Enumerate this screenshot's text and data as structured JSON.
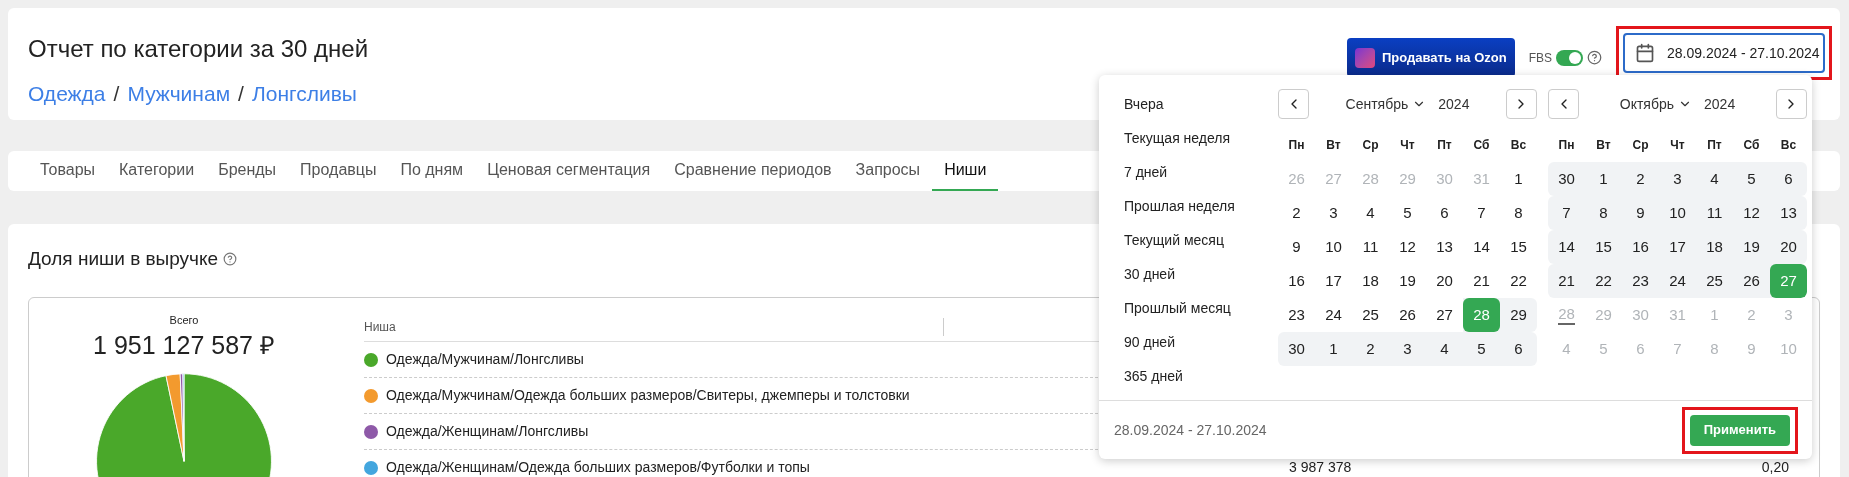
{
  "header": {
    "title": "Отчет по категории за 30 дней",
    "breadcrumbs": [
      "Одежда",
      "Мужчинам",
      "Лонгсливы"
    ],
    "separators": [
      "/",
      "/"
    ],
    "sell_button": "Продавать на Ozon",
    "fbs": {
      "label": "FBS",
      "on": true
    },
    "date_range": {
      "value": "28.09.2024 - 27.10.2024",
      "highlighted": true
    }
  },
  "tabs": [
    {
      "label": "Товары",
      "selected": false
    },
    {
      "label": "Категории",
      "selected": false
    },
    {
      "label": "Бренды",
      "selected": false
    },
    {
      "label": "Продавцы",
      "selected": false
    },
    {
      "label": "По дням",
      "selected": false
    },
    {
      "label": "Ценовая сегментация",
      "selected": false
    },
    {
      "label": "Сравнение периодов",
      "selected": false
    },
    {
      "label": "Запросы",
      "selected": false
    },
    {
      "label": "Ниши",
      "selected": true
    }
  ],
  "section": {
    "title": "Доля ниши в выручке",
    "total_label": "Всего",
    "total": "1 951 127 587 ₽",
    "columns": [
      "Ниша"
    ],
    "rows": [
      {
        "name": "Одежда/Мужчинам/Лонгсливы",
        "color": "#4aa82a"
      },
      {
        "name": "Одежда/Мужчинам/Одежда больших размеров/Свитеры, джемперы и толстовки",
        "color": "#f39a2e"
      },
      {
        "name": "Одежда/Женщинам/Лонгсливы",
        "color": "#8e59a8"
      },
      {
        "name": "Одежда/Женщинам/Одежда больших размеров/Футболки и топы",
        "color": "#43a6de",
        "column_2": "3 987 378",
        "column_3": "0,20"
      }
    ]
  },
  "calendar": {
    "presets": [
      "Вчера",
      "Текущая неделя",
      "7 дней",
      "Прошлая неделя",
      "Текущий месяц",
      "30 дней",
      "Прошлый месяц",
      "90 дней",
      "365 дней"
    ],
    "months": [
      {
        "month": "Сентябрь",
        "year": "2024",
        "weekdays": [
          "Пн",
          "Вт",
          "Ср",
          "Чт",
          "Пт",
          "Сб",
          "Вс"
        ],
        "weeks": [
          [
            {
              "d": "26",
              "muted": true,
              "in_range": false,
              "selected": false,
              "today": false
            },
            {
              "d": "27",
              "muted": true,
              "in_range": false,
              "selected": false,
              "today": false
            },
            {
              "d": "28",
              "muted": true,
              "in_range": false,
              "selected": false,
              "today": false
            },
            {
              "d": "29",
              "muted": true,
              "in_range": false,
              "selected": false,
              "today": false
            },
            {
              "d": "30",
              "muted": true,
              "in_range": false,
              "selected": false,
              "today": false
            },
            {
              "d": "31",
              "muted": true,
              "in_range": false,
              "selected": false,
              "today": false
            },
            {
              "d": "1",
              "muted": false,
              "in_range": false,
              "selected": false,
              "today": false
            }
          ],
          [
            {
              "d": "2",
              "muted": false,
              "in_range": false,
              "selected": false,
              "today": false
            },
            {
              "d": "3",
              "muted": false,
              "in_range": false,
              "selected": false,
              "today": false
            },
            {
              "d": "4",
              "muted": false,
              "in_range": false,
              "selected": false,
              "today": false
            },
            {
              "d": "5",
              "muted": false,
              "in_range": false,
              "selected": false,
              "today": false
            },
            {
              "d": "6",
              "muted": false,
              "in_range": false,
              "selected": false,
              "today": false
            },
            {
              "d": "7",
              "muted": false,
              "in_range": false,
              "selected": false,
              "today": false
            },
            {
              "d": "8",
              "muted": false,
              "in_range": false,
              "selected": false,
              "today": false
            }
          ],
          [
            {
              "d": "9",
              "muted": false,
              "in_range": false,
              "selected": false,
              "today": false
            },
            {
              "d": "10",
              "muted": false,
              "in_range": false,
              "selected": false,
              "today": false
            },
            {
              "d": "11",
              "muted": false,
              "in_range": false,
              "selected": false,
              "today": false
            },
            {
              "d": "12",
              "muted": false,
              "in_range": false,
              "selected": false,
              "today": false
            },
            {
              "d": "13",
              "muted": false,
              "in_range": false,
              "selected": false,
              "today": false
            },
            {
              "d": "14",
              "muted": false,
              "in_range": false,
              "selected": false,
              "today": false
            },
            {
              "d": "15",
              "muted": false,
              "in_range": false,
              "selected": false,
              "today": false
            }
          ],
          [
            {
              "d": "16",
              "muted": false,
              "in_range": false,
              "selected": false,
              "today": false
            },
            {
              "d": "17",
              "muted": false,
              "in_range": false,
              "selected": false,
              "today": false
            },
            {
              "d": "18",
              "muted": false,
              "in_range": false,
              "selected": false,
              "today": false
            },
            {
              "d": "19",
              "muted": false,
              "in_range": false,
              "selected": false,
              "today": false
            },
            {
              "d": "20",
              "muted": false,
              "in_range": false,
              "selected": false,
              "today": false
            },
            {
              "d": "21",
              "muted": false,
              "in_range": false,
              "selected": false,
              "today": false
            },
            {
              "d": "22",
              "muted": false,
              "in_range": false,
              "selected": false,
              "today": false
            }
          ],
          [
            {
              "d": "23",
              "muted": false,
              "in_range": false,
              "selected": false,
              "today": false
            },
            {
              "d": "24",
              "muted": false,
              "in_range": false,
              "selected": false,
              "today": false
            },
            {
              "d": "25",
              "muted": false,
              "in_range": false,
              "selected": false,
              "today": false
            },
            {
              "d": "26",
              "muted": false,
              "in_range": false,
              "selected": false,
              "today": false
            },
            {
              "d": "27",
              "muted": false,
              "in_range": false,
              "selected": false,
              "today": false
            },
            {
              "d": "28",
              "muted": false,
              "in_range": true,
              "selected": true,
              "today": false
            },
            {
              "d": "29",
              "muted": false,
              "in_range": true,
              "selected": false,
              "today": false
            }
          ],
          [
            {
              "d": "30",
              "muted": false,
              "in_range": true,
              "selected": false,
              "today": false
            },
            {
              "d": "1",
              "muted": false,
              "in_range": true,
              "selected": false,
              "today": false
            },
            {
              "d": "2",
              "muted": false,
              "in_range": true,
              "selected": false,
              "today": false
            },
            {
              "d": "3",
              "muted": false,
              "in_range": true,
              "selected": false,
              "today": false
            },
            {
              "d": "4",
              "muted": false,
              "in_range": true,
              "selected": false,
              "today": false
            },
            {
              "d": "5",
              "muted": false,
              "in_range": true,
              "selected": false,
              "today": false
            },
            {
              "d": "6",
              "muted": false,
              "in_range": true,
              "selected": false,
              "today": false
            }
          ]
        ]
      },
      {
        "month": "Октябрь",
        "year": "2024",
        "weekdays": [
          "Пн",
          "Вт",
          "Ср",
          "Чт",
          "Пт",
          "Сб",
          "Вс"
        ],
        "weeks": [
          [
            {
              "d": "30",
              "muted": false,
              "in_range": true,
              "selected": false,
              "today": false
            },
            {
              "d": "1",
              "muted": false,
              "in_range": true,
              "selected": false,
              "today": false
            },
            {
              "d": "2",
              "muted": false,
              "in_range": true,
              "selected": false,
              "today": false
            },
            {
              "d": "3",
              "muted": false,
              "in_range": true,
              "selected": false,
              "today": false
            },
            {
              "d": "4",
              "muted": false,
              "in_range": true,
              "selected": false,
              "today": false
            },
            {
              "d": "5",
              "muted": false,
              "in_range": true,
              "selected": false,
              "today": false
            },
            {
              "d": "6",
              "muted": false,
              "in_range": true,
              "selected": false,
              "today": false
            }
          ],
          [
            {
              "d": "7",
              "muted": false,
              "in_range": true,
              "selected": false,
              "today": false
            },
            {
              "d": "8",
              "muted": false,
              "in_range": true,
              "selected": false,
              "today": false
            },
            {
              "d": "9",
              "muted": false,
              "in_range": true,
              "selected": false,
              "today": false
            },
            {
              "d": "10",
              "muted": false,
              "in_range": true,
              "selected": false,
              "today": false
            },
            {
              "d": "11",
              "muted": false,
              "in_range": true,
              "selected": false,
              "today": false
            },
            {
              "d": "12",
              "muted": false,
              "in_range": true,
              "selected": false,
              "today": false
            },
            {
              "d": "13",
              "muted": false,
              "in_range": true,
              "selected": false,
              "today": false
            }
          ],
          [
            {
              "d": "14",
              "muted": false,
              "in_range": true,
              "selected": false,
              "today": false
            },
            {
              "d": "15",
              "muted": false,
              "in_range": true,
              "selected": false,
              "today": false
            },
            {
              "d": "16",
              "muted": false,
              "in_range": true,
              "selected": false,
              "today": false
            },
            {
              "d": "17",
              "muted": false,
              "in_range": true,
              "selected": false,
              "today": false
            },
            {
              "d": "18",
              "muted": false,
              "in_range": true,
              "selected": false,
              "today": false
            },
            {
              "d": "19",
              "muted": false,
              "in_range": true,
              "selected": false,
              "today": false
            },
            {
              "d": "20",
              "muted": false,
              "in_range": true,
              "selected": false,
              "today": false
            }
          ],
          [
            {
              "d": "21",
              "muted": false,
              "in_range": true,
              "selected": false,
              "today": false
            },
            {
              "d": "22",
              "muted": false,
              "in_range": true,
              "selected": false,
              "today": false
            },
            {
              "d": "23",
              "muted": false,
              "in_range": true,
              "selected": false,
              "today": false
            },
            {
              "d": "24",
              "muted": false,
              "in_range": true,
              "selected": false,
              "today": false
            },
            {
              "d": "25",
              "muted": false,
              "in_range": true,
              "selected": false,
              "today": false
            },
            {
              "d": "26",
              "muted": false,
              "in_range": true,
              "selected": false,
              "today": false
            },
            {
              "d": "27",
              "muted": false,
              "in_range": true,
              "selected": true,
              "today": false
            }
          ],
          [
            {
              "d": "28",
              "muted": true,
              "in_range": false,
              "selected": false,
              "today": true
            },
            {
              "d": "29",
              "muted": true,
              "in_range": false,
              "selected": false,
              "today": false
            },
            {
              "d": "30",
              "muted": true,
              "in_range": false,
              "selected": false,
              "today": false
            },
            {
              "d": "31",
              "muted": true,
              "in_range": false,
              "selected": false,
              "today": false
            },
            {
              "d": "1",
              "muted": true,
              "in_range": false,
              "selected": false,
              "today": false
            },
            {
              "d": "2",
              "muted": true,
              "in_range": false,
              "selected": false,
              "today": false
            },
            {
              "d": "3",
              "muted": true,
              "in_range": false,
              "selected": false,
              "today": false
            }
          ],
          [
            {
              "d": "4",
              "muted": true,
              "in_range": false,
              "selected": false,
              "today": false
            },
            {
              "d": "5",
              "muted": true,
              "in_range": false,
              "selected": false,
              "today": false
            },
            {
              "d": "6",
              "muted": true,
              "in_range": false,
              "selected": false,
              "today": false
            },
            {
              "d": "7",
              "muted": true,
              "in_range": false,
              "selected": false,
              "today": false
            },
            {
              "d": "8",
              "muted": true,
              "in_range": false,
              "selected": false,
              "today": false
            },
            {
              "d": "9",
              "muted": true,
              "in_range": false,
              "selected": false,
              "today": false
            },
            {
              "d": "10",
              "muted": true,
              "in_range": false,
              "selected": false,
              "today": false
            }
          ]
        ]
      }
    ],
    "footer_range": "28.09.2024 - 27.10.2024",
    "apply": {
      "label": "Применить",
      "highlighted": true
    }
  }
}
